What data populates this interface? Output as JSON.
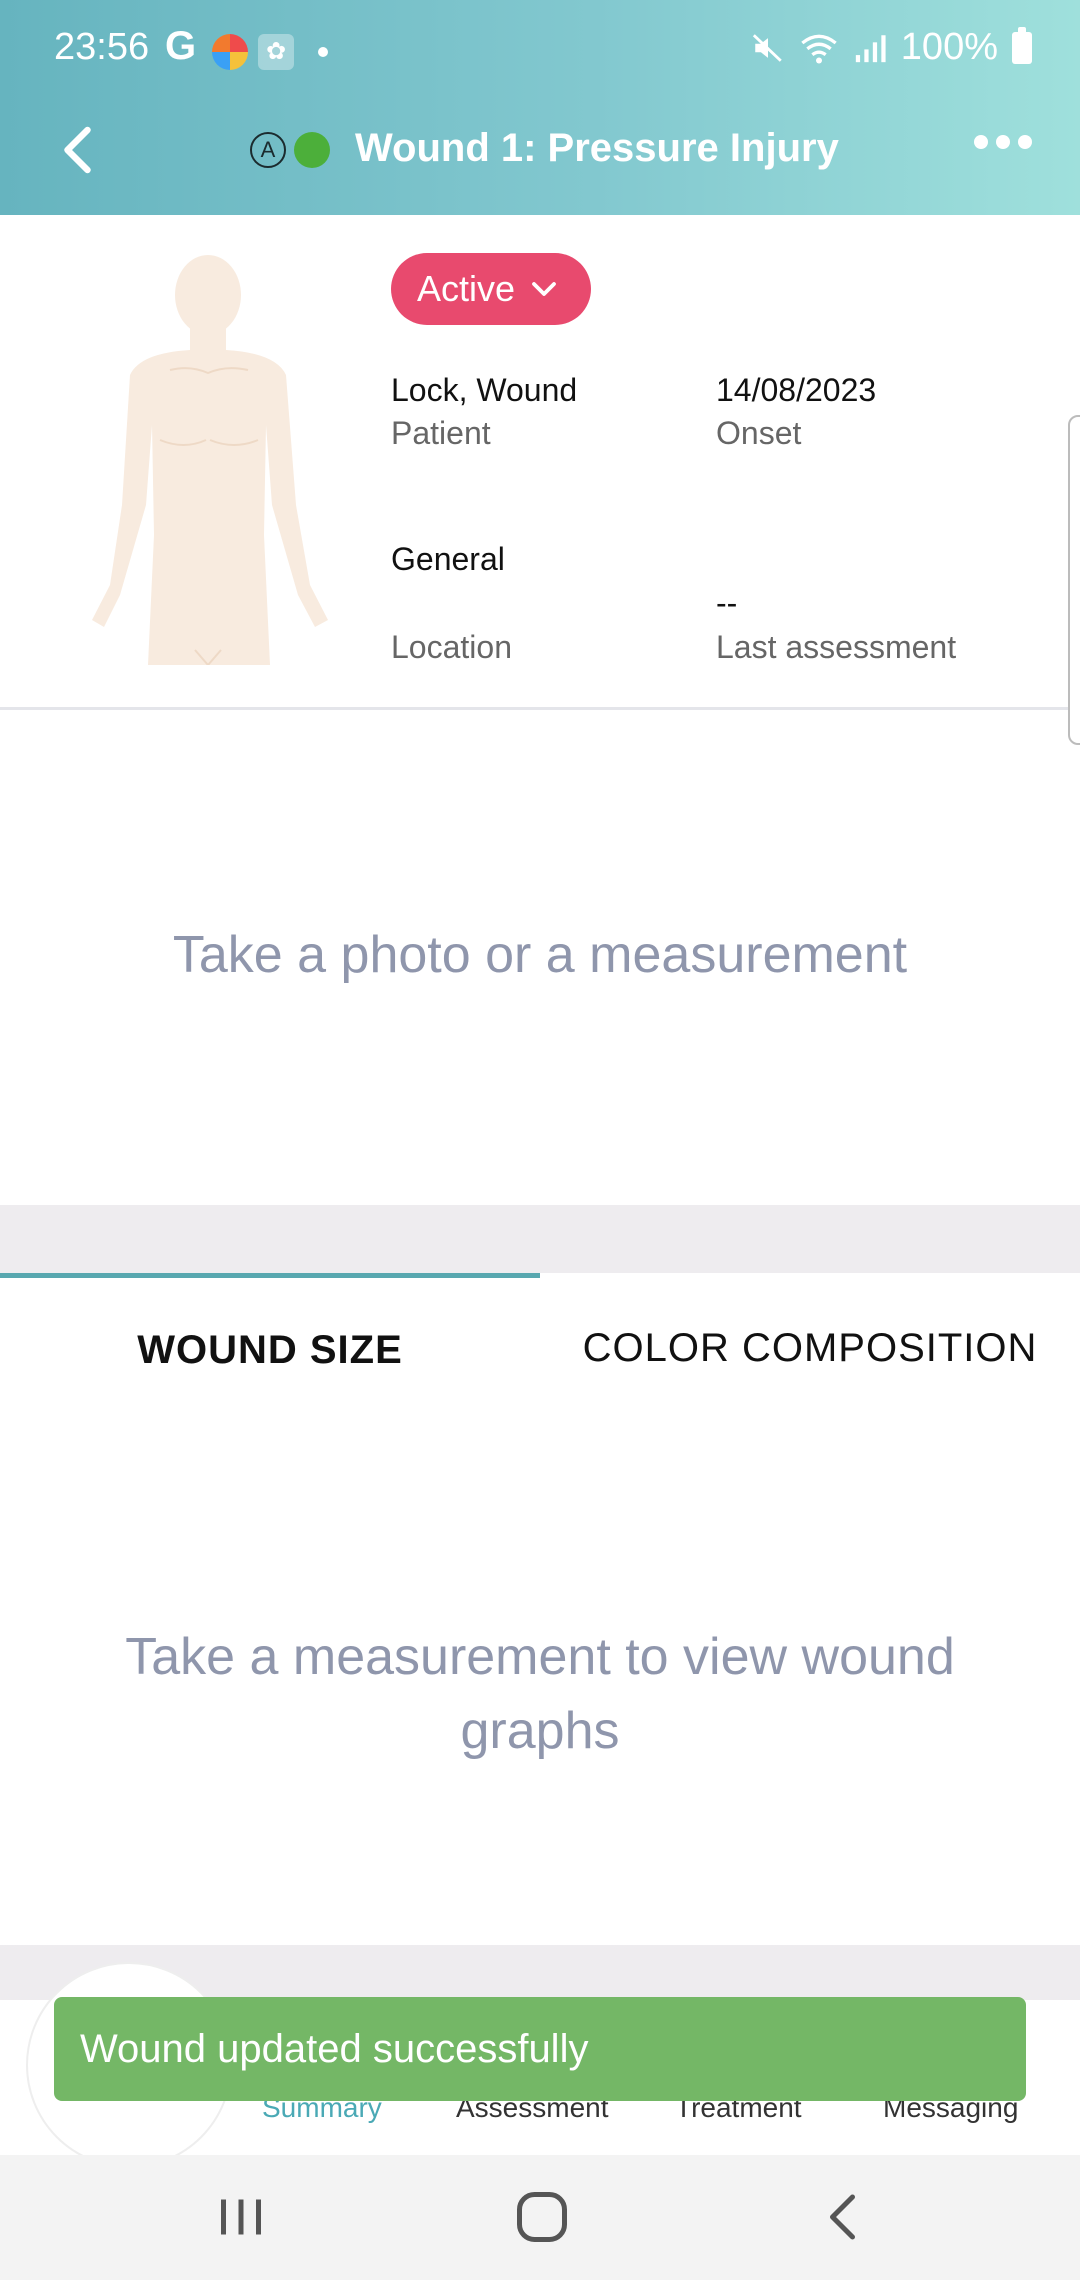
{
  "status_bar": {
    "time": "23:56",
    "google_glyph": "G",
    "battery": "100%",
    "icons": [
      "google-icon",
      "app-icon",
      "app-icon-2",
      "notification-dot",
      "mute-icon",
      "wifi-icon",
      "signal-icon",
      "battery-icon"
    ]
  },
  "app_bar": {
    "title": "Wound 1: Pressure Injury",
    "badge_letter": "A",
    "status_dot_color": "#4caf3a"
  },
  "wound": {
    "status": "Active",
    "patient_value": "Lock, Wound",
    "patient_label": "Patient",
    "onset_value": "14/08/2023",
    "onset_label": "Onset",
    "location_value": "General",
    "location_label": "Location",
    "last_assessment_value": "--",
    "last_assessment_label": "Last assessment"
  },
  "photo_placeholder": "Take a photo or a measurement",
  "tabs": [
    {
      "label": "WOUND SIZE",
      "active": true
    },
    {
      "label": "COLOR COMPOSITION",
      "active": false
    }
  ],
  "graph_placeholder": "Take a measurement to view wound graphs",
  "bottom_nav": [
    {
      "label": "Summary",
      "active": true
    },
    {
      "label": "Assessment",
      "active": false
    },
    {
      "label": "Treatment",
      "active": false
    },
    {
      "label": "Messaging",
      "active": false
    }
  ],
  "toast": "Wound updated successfully",
  "colors": {
    "header_start": "#66b4bf",
    "header_end": "#9fe0dc",
    "status_pill": "#e84a6e",
    "tab_indicator": "#58a7af",
    "toast": "#74b766",
    "nav_active": "#4aa9b5"
  }
}
